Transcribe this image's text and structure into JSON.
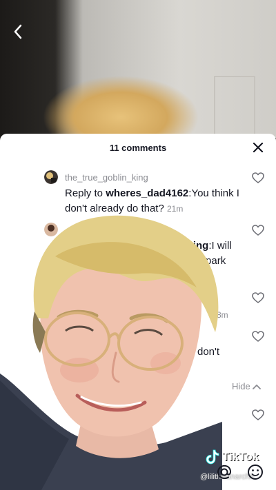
{
  "sheet": {
    "count_label": "11 comments"
  },
  "comments": [
    {
      "username": "the_true_goblin_king",
      "reply_label": "Reply to ",
      "reply_user": "wheres_dad4162",
      "text": ":You think I don't already do that?",
      "time": "21m"
    },
    {
      "username_partial": "n_king",
      "text_partial_1": ":I will",
      "text_partial_2": "e spark"
    },
    {
      "time_partial": "8m"
    },
    {
      "text_partial": "don't"
    }
  ],
  "hide_label": "Hide",
  "watermark": {
    "brand": "TikTok",
    "handle": "@lilithisanarchic"
  },
  "icons": {
    "back": "chevron-left-icon",
    "close": "close-icon",
    "like": "heart-outline-icon",
    "hide": "chevron-up-icon",
    "mention": "at-sign-icon",
    "emoji": "emoji-icon"
  },
  "colors": {
    "text_primary": "#161823",
    "text_secondary": "#8a8b91",
    "sheet_bg": "#ffffff"
  }
}
